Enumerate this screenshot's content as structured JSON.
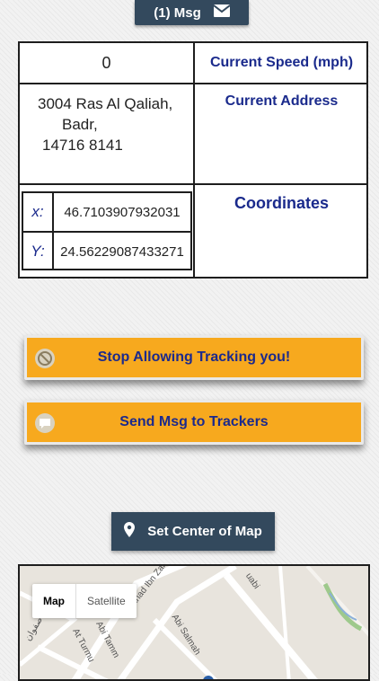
{
  "header": {
    "msg_label": "(1) Msg",
    "icon": "envelope-icon"
  },
  "info": {
    "speed_value": "0",
    "speed_label": "Current Speed (mph)",
    "address_lines": [
      "3004 Ras Al Qaliah,",
      "Badr,",
      "14716 8141"
    ],
    "address_label": "Current Address",
    "coordinates_label": "Coordinates",
    "x_label": "x:",
    "x_value": "46.7103907932031",
    "y_label": "Y:",
    "y_value": "24.56229087433271"
  },
  "actions": {
    "stop_tracking_label": "Stop Allowing Tracking you!",
    "stop_icon": "prohibited-icon",
    "send_msg_label": "Send Msg to Trackers",
    "send_icon": "chat-bubble-icon",
    "set_center_label": "Set Center of Map",
    "set_center_icon": "map-pin-icon"
  },
  "map": {
    "type_map": "Map",
    "type_satellite": "Satellite",
    "street_labels": [
      "Fahad Ibn Zar",
      "Abi Salmah",
      "Abi Tamm",
      "At Turmu",
      "صفوان",
      "uabi"
    ]
  },
  "colors": {
    "accent_orange": "#f7a91e",
    "dark_button": "#33495d",
    "label_blue": "#1a2a8c"
  }
}
